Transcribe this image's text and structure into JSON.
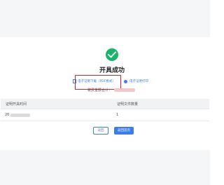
{
  "result": {
    "title": "开具成功",
    "download_label": "电子证明下载（PDF格式）",
    "print_label": "电子证明打印",
    "amount_label": "税费金额合计："
  },
  "table": {
    "headers": [
      "证明开具时间",
      "证明文件数量"
    ],
    "rows": [
      {
        "time": "20",
        "count": "1"
      }
    ]
  },
  "buttons": {
    "return_label": "返回",
    "home_label": "返回首页"
  },
  "colors": {
    "success": "#19b36b",
    "link": "#3c7dea",
    "highlight_box": "#e02020"
  }
}
